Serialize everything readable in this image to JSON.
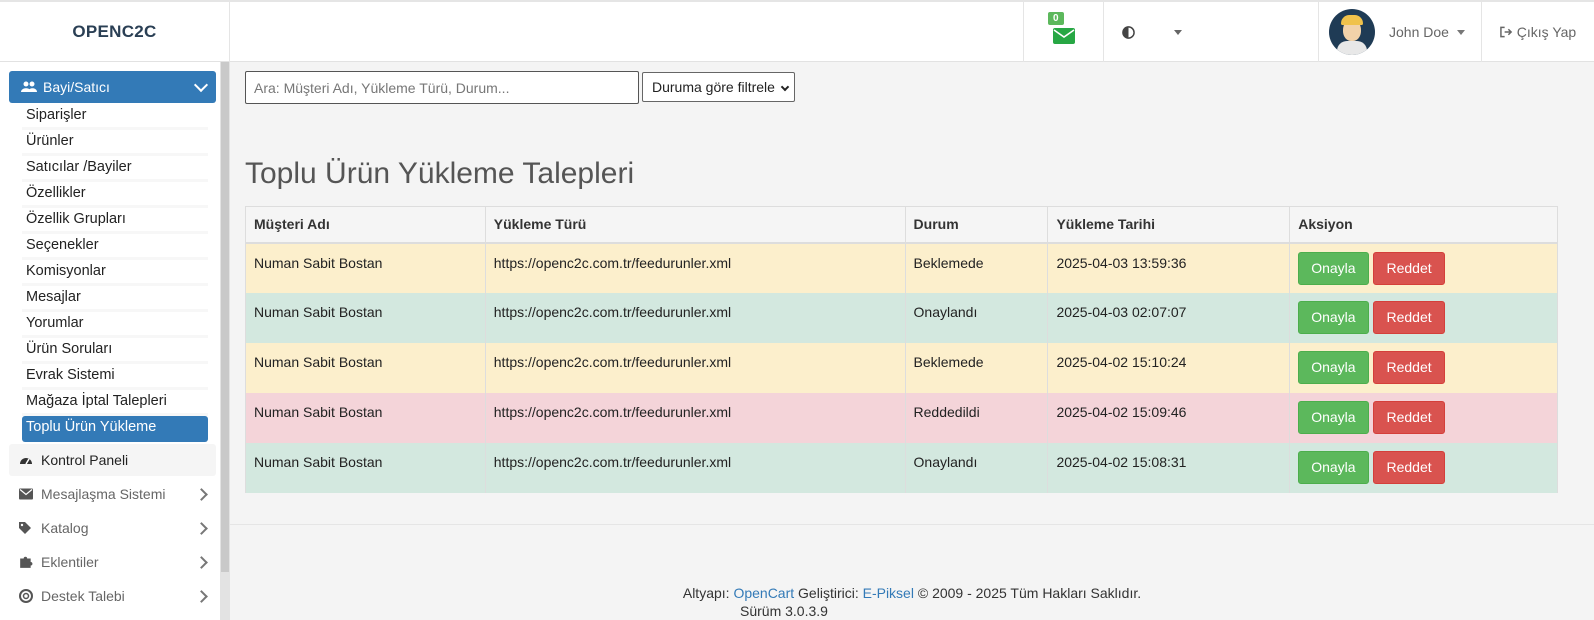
{
  "brand": "OPENC2C",
  "header": {
    "mail_count": "0",
    "user_name": "John Doe",
    "logout_label": "Çıkış Yap"
  },
  "sidebar": {
    "active_section": "Bayi/Satıcı",
    "submenu": [
      "Siparişler",
      "Ürünler",
      "Satıcılar /Bayiler",
      "Özellikler",
      "Özellik Grupları",
      "Seçenekler",
      "Komisyonlar",
      "Mesajlar",
      "Yorumlar",
      "Ürün Soruları",
      "Evrak Sistemi",
      "Mağaza İptal Talepleri",
      "Toplu Ürün Yükleme"
    ],
    "active_submenu": "Toplu Ürün Yükleme",
    "items": [
      {
        "label": "Kontrol Paneli",
        "icon": "dashboard-icon"
      },
      {
        "label": "Mesajlaşma Sistemi",
        "icon": "envelope-icon"
      },
      {
        "label": "Katalog",
        "icon": "tags-icon"
      },
      {
        "label": "Eklentiler",
        "icon": "puzzle-icon"
      },
      {
        "label": "Destek Talebi",
        "icon": "lifebuoy-icon"
      }
    ]
  },
  "search": {
    "placeholder": "Ara: Müşteri Adı, Yükleme Türü, Durum...",
    "filter_label": "Duruma göre filtrele"
  },
  "page_title": "Toplu Ürün Yükleme Talepleri",
  "table": {
    "columns": [
      "Müşteri Adı",
      "Yükleme Türü",
      "Durum",
      "Yükleme Tarihi",
      "Aksiyon"
    ],
    "rows": [
      {
        "customer": "Numan Sabit Bostan",
        "type": "https://openc2c.com.tr/feedurunler.xml",
        "status": "Beklemede",
        "date": "2025-04-03 13:59:36",
        "row_state": "warning"
      },
      {
        "customer": "Numan Sabit Bostan",
        "type": "https://openc2c.com.tr/feedurunler.xml",
        "status": "Onaylandı",
        "date": "2025-04-03 02:07:07",
        "row_state": "success"
      },
      {
        "customer": "Numan Sabit Bostan",
        "type": "https://openc2c.com.tr/feedurunler.xml",
        "status": "Beklemede",
        "date": "2025-04-02 15:10:24",
        "row_state": "warning"
      },
      {
        "customer": "Numan Sabit Bostan",
        "type": "https://openc2c.com.tr/feedurunler.xml",
        "status": "Reddedildi",
        "date": "2025-04-02 15:09:46",
        "row_state": "danger"
      },
      {
        "customer": "Numan Sabit Bostan",
        "type": "https://openc2c.com.tr/feedurunler.xml",
        "status": "Onaylandı",
        "date": "2025-04-02 15:08:31",
        "row_state": "success"
      }
    ],
    "approve_label": "Onayla",
    "reject_label": "Reddet"
  },
  "footer": {
    "prefix": "Altyapı:",
    "opencart": "OpenCart",
    "dev_prefix": "Geliştirici:",
    "developer": "E-Piksel",
    "rights": "© 2009 - 2025 Tüm Hakları Saklıdır.",
    "version": "Sürüm 3.0.3.9"
  },
  "colors": {
    "primary": "#337ab7",
    "success": "#5cb85c",
    "danger": "#d9534f",
    "row_warning": "#fcefcc",
    "row_success": "#d3e8df",
    "row_danger": "#f4d4d9"
  }
}
